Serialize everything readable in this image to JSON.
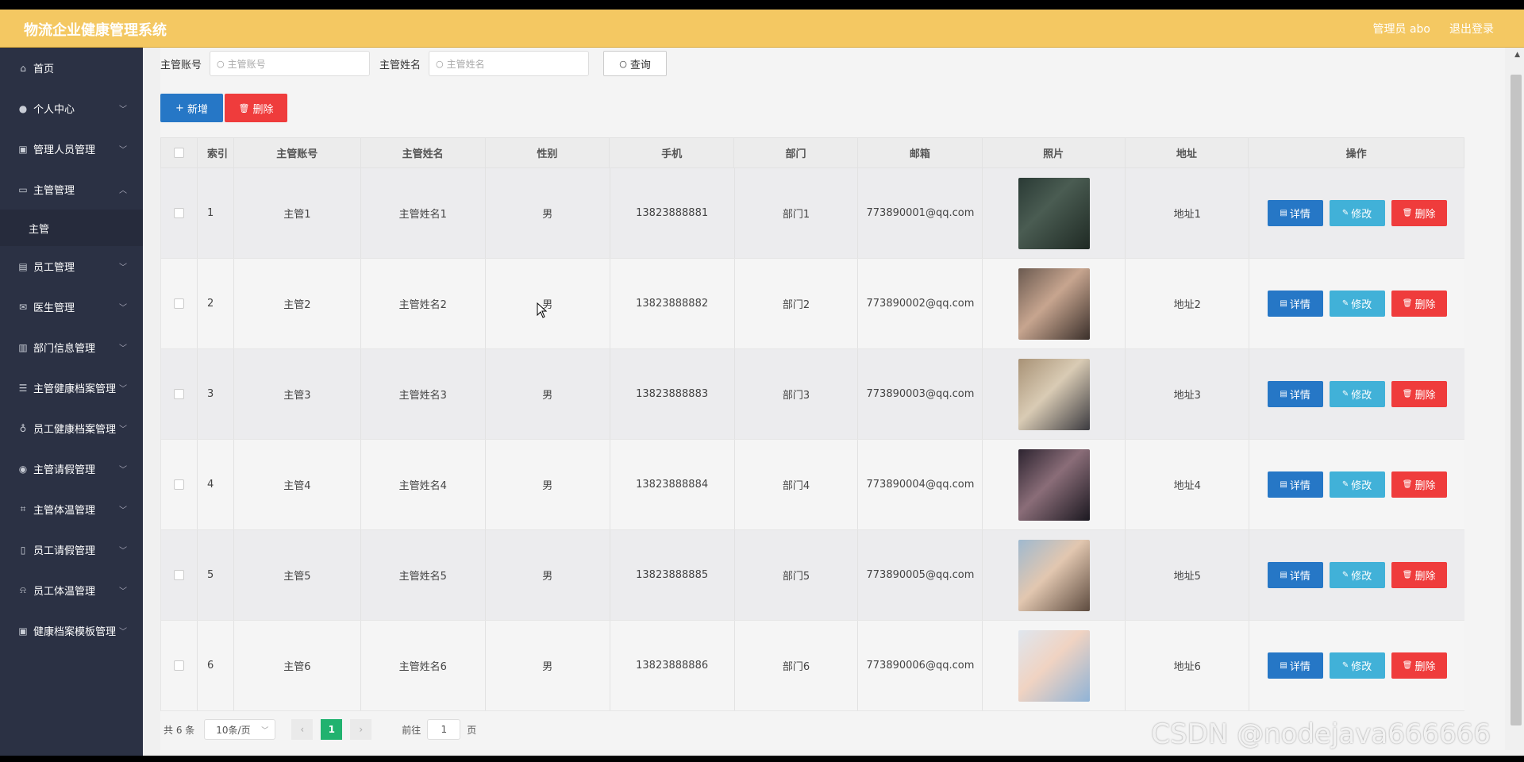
{
  "app": {
    "title": "物流企业健康管理系统",
    "user": "管理员 abo",
    "logout": "退出登录"
  },
  "sidebar": {
    "items": [
      {
        "label": "首页",
        "icon": "home-icon",
        "expandable": false
      },
      {
        "label": "个人中心",
        "icon": "user-icon",
        "expandable": true
      },
      {
        "label": "管理人员管理",
        "icon": "clipboard-icon",
        "expandable": true
      },
      {
        "label": "主管管理",
        "icon": "chat-icon",
        "expandable": true,
        "expanded": true
      },
      {
        "label": "员工管理",
        "icon": "briefcase-icon",
        "expandable": true
      },
      {
        "label": "医生管理",
        "icon": "mail-icon",
        "expandable": true
      },
      {
        "label": "部门信息管理",
        "icon": "bar-chart-icon",
        "expandable": true
      },
      {
        "label": "主管健康档案管理",
        "icon": "list-icon",
        "expandable": true
      },
      {
        "label": "员工健康档案管理",
        "icon": "microphone-icon",
        "expandable": true
      },
      {
        "label": "主管请假管理",
        "icon": "location-icon",
        "expandable": true
      },
      {
        "label": "主管体温管理",
        "icon": "crop-icon",
        "expandable": true
      },
      {
        "label": "员工请假管理",
        "icon": "phone-icon",
        "expandable": true
      },
      {
        "label": "员工体温管理",
        "icon": "bell-off-icon",
        "expandable": true
      },
      {
        "label": "健康档案模板管理",
        "icon": "clipboard-icon",
        "expandable": true
      }
    ],
    "submenu": {
      "label": "主管"
    }
  },
  "search": {
    "account_label": "主管账号",
    "account_placeholder": "主管账号",
    "name_label": "主管姓名",
    "name_placeholder": "主管姓名",
    "query_label": "查询"
  },
  "actions": {
    "add_label": "新增",
    "delete_label": "删除"
  },
  "table": {
    "headers": [
      "索引",
      "主管账号",
      "主管姓名",
      "性别",
      "手机",
      "部门",
      "邮箱",
      "照片",
      "地址",
      "操作"
    ],
    "rows": [
      {
        "idx": "1",
        "account": "主管1",
        "name": "主管姓名1",
        "sex": "男",
        "phone": "13823888881",
        "dept": "部门1",
        "email": "773890001@qq.com",
        "addr": "地址1"
      },
      {
        "idx": "2",
        "account": "主管2",
        "name": "主管姓名2",
        "sex": "男",
        "phone": "13823888882",
        "dept": "部门2",
        "email": "773890002@qq.com",
        "addr": "地址2"
      },
      {
        "idx": "3",
        "account": "主管3",
        "name": "主管姓名3",
        "sex": "男",
        "phone": "13823888883",
        "dept": "部门3",
        "email": "773890003@qq.com",
        "addr": "地址3"
      },
      {
        "idx": "4",
        "account": "主管4",
        "name": "主管姓名4",
        "sex": "男",
        "phone": "13823888884",
        "dept": "部门4",
        "email": "773890004@qq.com",
        "addr": "地址4"
      },
      {
        "idx": "5",
        "account": "主管5",
        "name": "主管姓名5",
        "sex": "男",
        "phone": "13823888885",
        "dept": "部门5",
        "email": "773890005@qq.com",
        "addr": "地址5"
      },
      {
        "idx": "6",
        "account": "主管6",
        "name": "主管姓名6",
        "sex": "男",
        "phone": "13823888886",
        "dept": "部门6",
        "email": "773890006@qq.com",
        "addr": "地址6"
      }
    ],
    "row_actions": {
      "detail": "详情",
      "edit": "修改",
      "delete": "删除"
    }
  },
  "pagination": {
    "total": "共 6 条",
    "page_size": "10条/页",
    "current_page": "1",
    "goto_label": "前往",
    "goto_value": "1",
    "page_suffix": "页"
  },
  "watermark": "CSDN @nodejava666666",
  "colors": {
    "header": "#f4c862",
    "sidebar": "#2b3144",
    "primary": "#2677c6",
    "info": "#41b1d8",
    "danger": "#ef3c3c",
    "pager_active": "#21b26f"
  }
}
